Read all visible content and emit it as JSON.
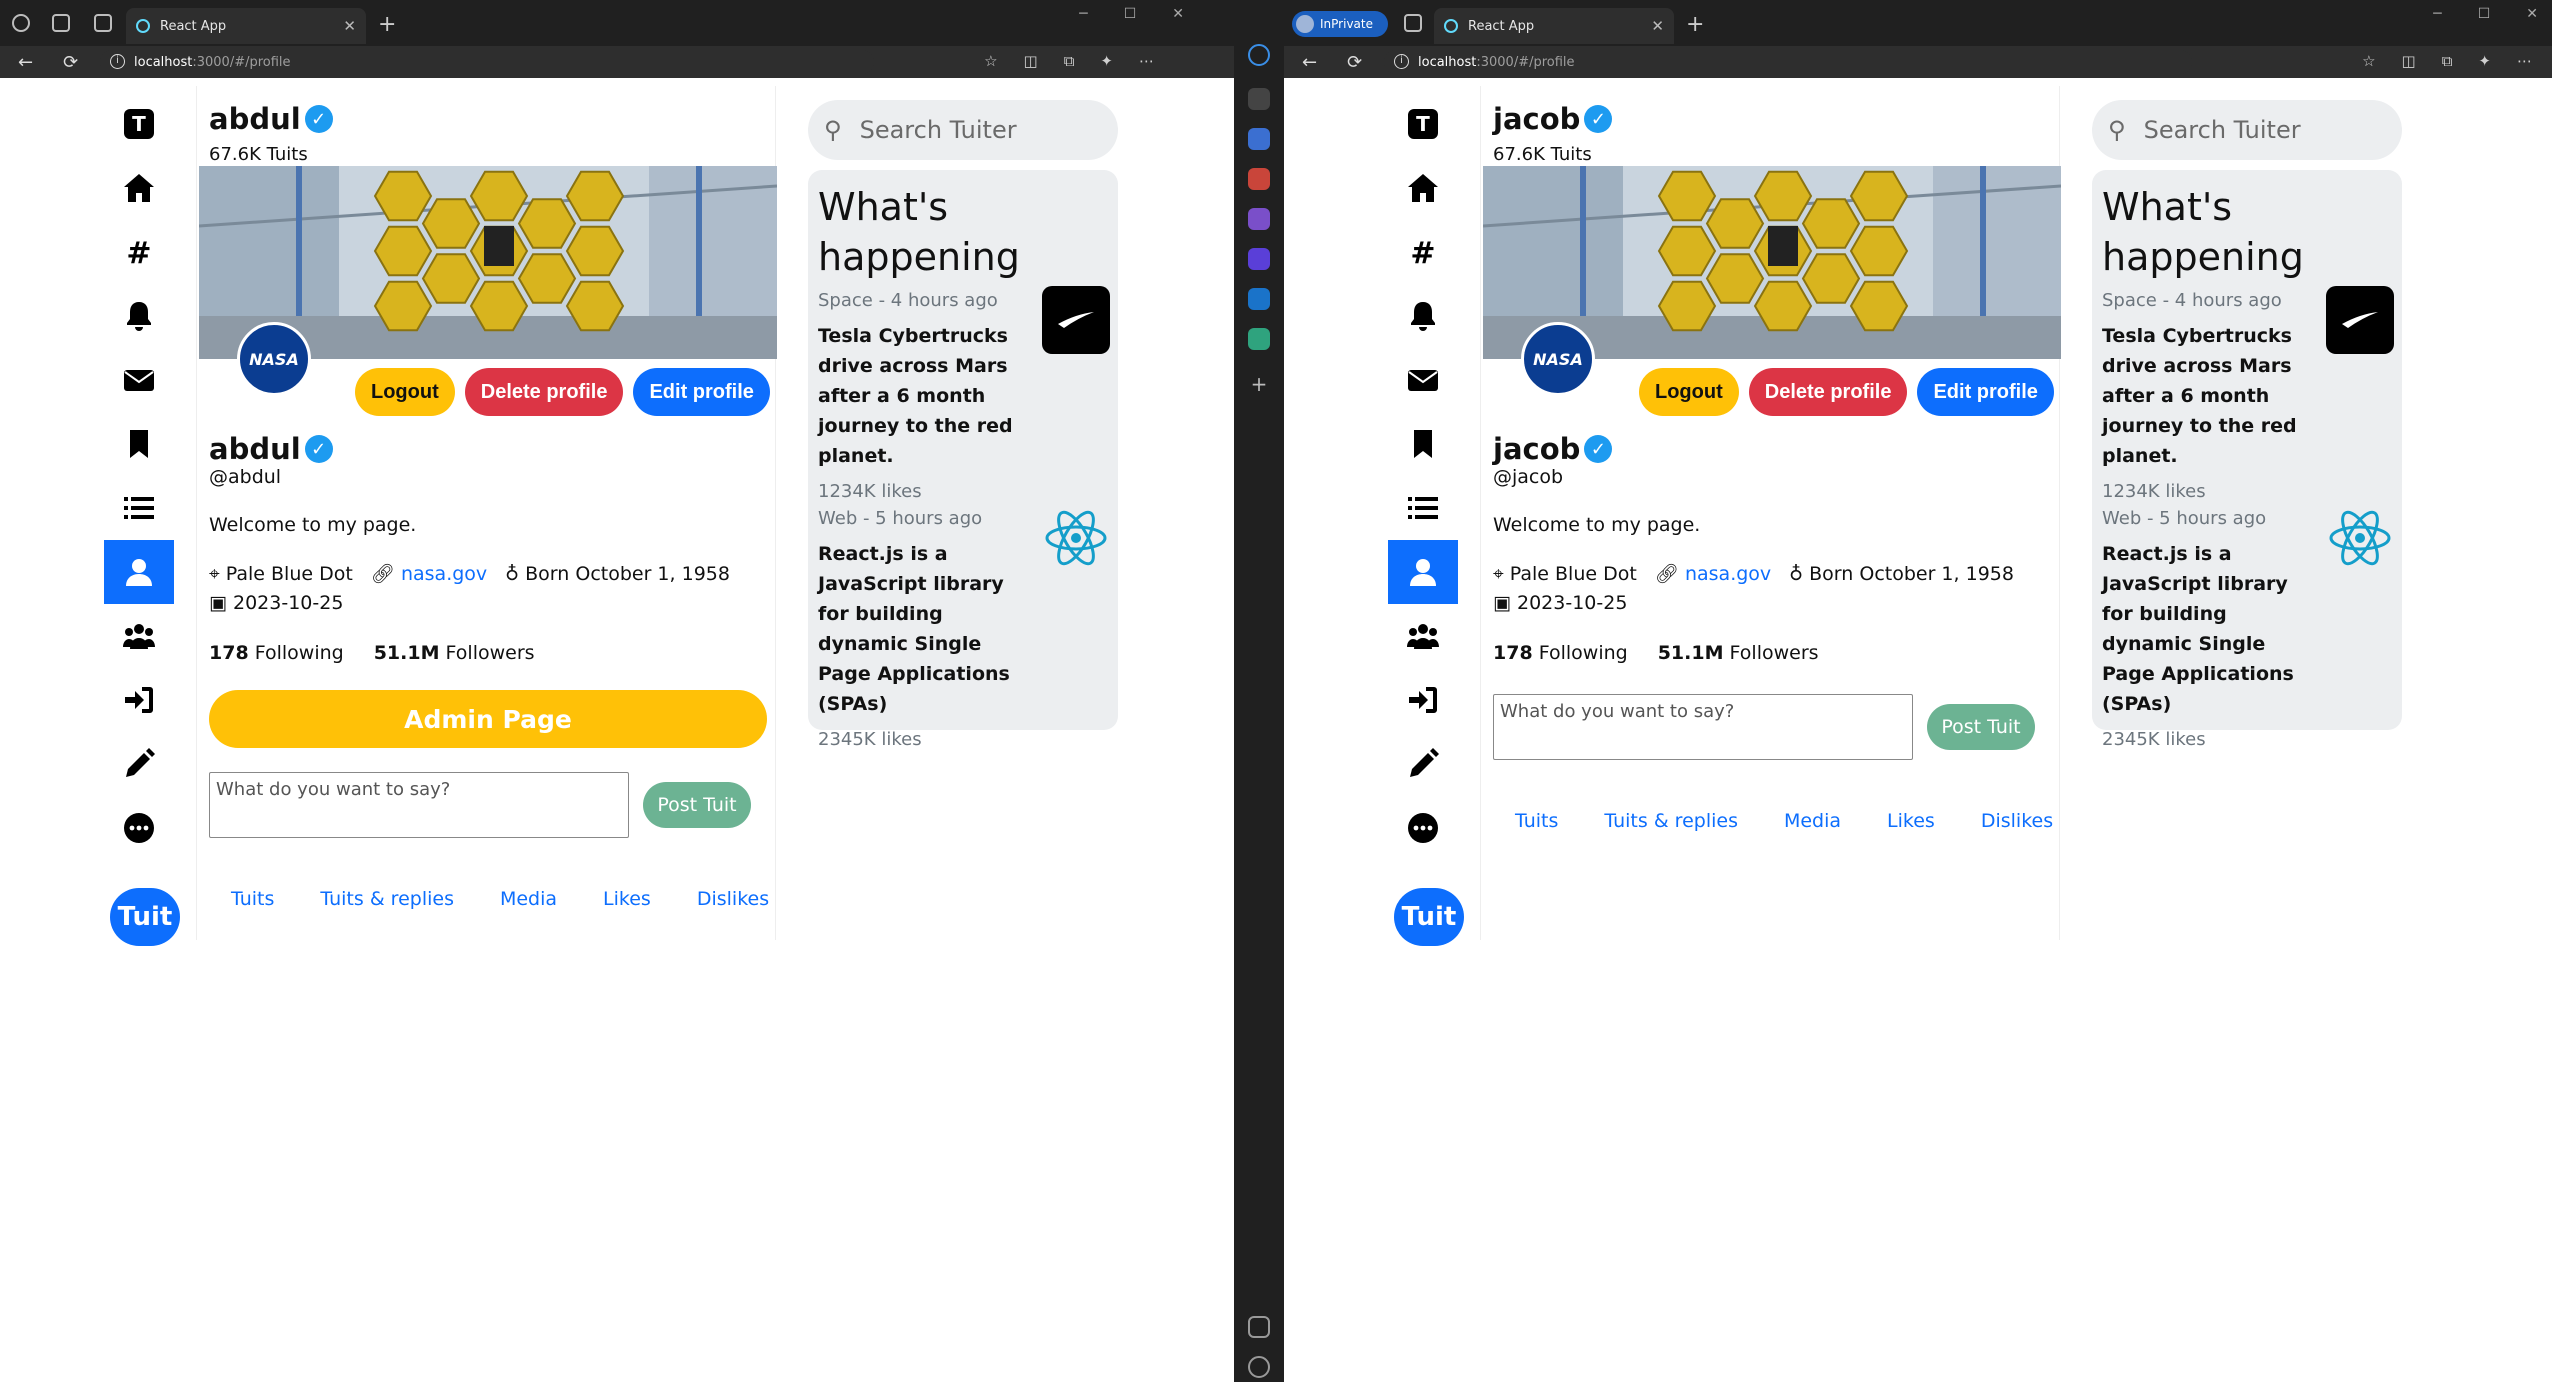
{
  "windows": [
    {
      "tab_title": "React App",
      "private_label": "",
      "url_host": "localhost",
      "url_rest": ":3000/#/profile",
      "profile": {
        "name": "abdul",
        "tuit_count": "67.6K Tuits",
        "handle": "@abdul",
        "bio": "Welcome to my page.",
        "location": "Pale Blue Dot",
        "website": "nasa.gov",
        "born": "Born October 1, 1958",
        "joined": "2023-10-25",
        "following_count": "178",
        "following_label": "Following",
        "followers_count": "51.1M",
        "followers_label": "Followers",
        "logout": "Logout",
        "delete": "Delete profile",
        "edit": "Edit profile",
        "admin": "Admin Page",
        "placeholder": "What do you want to say?",
        "post": "Post Tuit",
        "logo_text": "NASA",
        "tabs": [
          "Tuits",
          "Tuits & replies",
          "Media",
          "Likes",
          "Dislikes"
        ]
      }
    },
    {
      "tab_title": "React App",
      "private_label": "InPrivate",
      "url_host": "localhost",
      "url_rest": ":3000/#/profile",
      "profile": {
        "name": "jacob",
        "tuit_count": "67.6K Tuits",
        "handle": "@jacob",
        "bio": "Welcome to my page.",
        "location": "Pale Blue Dot",
        "website": "nasa.gov",
        "born": "Born October 1, 1958",
        "joined": "2023-10-25",
        "following_count": "178",
        "following_label": "Following",
        "followers_count": "51.1M",
        "followers_label": "Followers",
        "logout": "Logout",
        "delete": "Delete profile",
        "edit": "Edit profile",
        "admin": "",
        "placeholder": "What do you want to say?",
        "post": "Post Tuit",
        "logo_text": "NASA",
        "tabs": [
          "Tuits",
          "Tuits & replies",
          "Media",
          "Likes",
          "Dislikes"
        ]
      }
    }
  ],
  "sidebar": {
    "logo_letter": "T",
    "tuit_button": "Tuit",
    "icons": [
      "logo-icon",
      "home-icon",
      "explore-hash-icon",
      "notifications-bell-icon",
      "messages-envelope-icon",
      "bookmarks-icon",
      "lists-icon",
      "profile-user-icon",
      "people-icon",
      "login-icon",
      "edit-pencil-icon",
      "more-ellipsis-icon"
    ]
  },
  "whats_happening": {
    "search_placeholder": "Search Tuiter",
    "title": "What's happening",
    "items": [
      {
        "category": "Space - 4 hours ago",
        "title": "Tesla Cybertrucks drive across Mars after a 6 month journey to the red planet.",
        "likes": "1234K likes"
      },
      {
        "category": "Web - 5 hours ago",
        "title": "React.js is a JavaScript library for building dynamic Single Page Applications (SPAs)",
        "likes": "2345K likes"
      }
    ]
  },
  "colors": {
    "primary": "#0d6efd",
    "warning": "#ffc107",
    "danger": "#dc3545",
    "post": "#6cb393"
  }
}
